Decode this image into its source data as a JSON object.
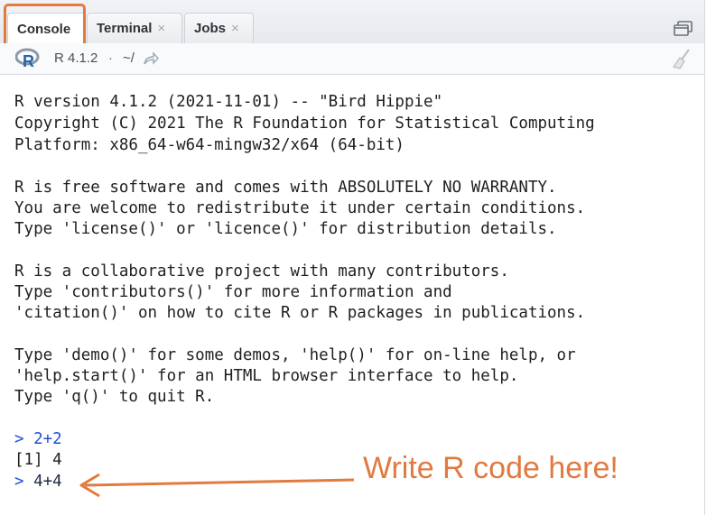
{
  "tabs": [
    {
      "label": "Console",
      "closable": false,
      "active": true
    },
    {
      "label": "Terminal",
      "closable": true,
      "active": false
    },
    {
      "label": "Jobs",
      "closable": true,
      "active": false
    }
  ],
  "close_glyph": "×",
  "toolbar": {
    "r_version": "R 4.1.2",
    "separator": "·",
    "working_dir": "~/"
  },
  "console": {
    "banner": [
      "R version 4.1.2 (2021-11-01) -- \"Bird Hippie\"",
      "Copyright (C) 2021 The R Foundation for Statistical Computing",
      "Platform: x86_64-w64-mingw32/x64 (64-bit)",
      "",
      "R is free software and comes with ABSOLUTELY NO WARRANTY.",
      "You are welcome to redistribute it under certain conditions.",
      "Type 'license()' or 'licence()' for distribution details.",
      "",
      "R is a collaborative project with many contributors.",
      "Type 'contributors()' for more information and",
      "'citation()' on how to cite R or R packages in publications.",
      "",
      "Type 'demo()' for some demos, 'help()' for on-line help, or",
      "'help.start()' for an HTML browser interface to help.",
      "Type 'q()' to quit R."
    ],
    "prompt": ">",
    "command1": "2+2",
    "output1": "[1] 4",
    "current_input": "4+4"
  },
  "annotation": "Write R code here!",
  "colors": {
    "accent": "#e27a3f",
    "prompt": "#1f4fd6"
  },
  "icons": {
    "r_logo": "r-logo-icon",
    "goto_dir": "share-arrow-icon",
    "clear": "broom-icon",
    "maximize": "maximize-icon"
  }
}
